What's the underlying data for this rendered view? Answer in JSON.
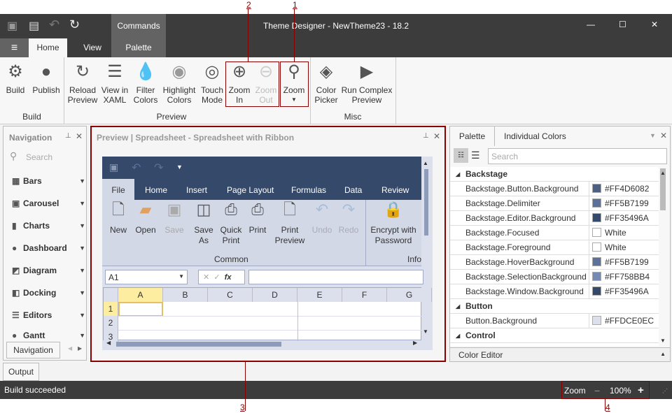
{
  "window": {
    "title": "Theme Designer  - NewTheme23 - 18.2",
    "context_tab": "Commands",
    "minimize": "—",
    "maximize": "☐",
    "close": "✕"
  },
  "qat": {
    "save": "save-icon",
    "save_all": "save-all-icon",
    "undo": "undo-icon",
    "redo": "redo-icon"
  },
  "tabs": {
    "menu": "≡",
    "home": "Home",
    "view": "View",
    "palette": "Palette"
  },
  "ribbon": {
    "groups": [
      {
        "label": "Build",
        "items": [
          {
            "label": "Build",
            "icon": "gear-icon"
          },
          {
            "label": "Publish",
            "icon": "globe-icon"
          }
        ]
      },
      {
        "label": "Preview",
        "items": [
          {
            "label": "Reload\nPreview"
          },
          {
            "label": "View in\nXAML"
          },
          {
            "label": "Filter\nColors"
          },
          {
            "label": "Highlight\nColors"
          },
          {
            "label": "Touch\nMode"
          },
          {
            "label": "Zoom\nIn"
          },
          {
            "label": "Zoom\nOut"
          },
          {
            "label": "Zoom"
          }
        ]
      },
      {
        "label": "Misc",
        "items": [
          {
            "label": "Color\nPicker"
          },
          {
            "label": "Run Complex\nPreview"
          }
        ]
      }
    ]
  },
  "callouts": [
    "1",
    "2",
    "3",
    "4"
  ],
  "navigation": {
    "title": "Navigation",
    "search_placeholder": "Search",
    "items": [
      "Bars",
      "Carousel",
      "Charts",
      "Dashboard",
      "Diagram",
      "Docking",
      "Editors",
      "Gantt"
    ],
    "bottom_tab": "Navigation"
  },
  "preview": {
    "title": "Preview | Spreadsheet - Spreadsheet with Ribbon",
    "tabs": [
      "File",
      "Home",
      "Insert",
      "Page Layout",
      "Formulas",
      "Data",
      "Review"
    ],
    "buttons": [
      "New",
      "Open",
      "Save",
      "Save\nAs",
      "Quick\nPrint",
      "Print",
      "Print\nPreview",
      "Undo",
      "Redo",
      "Encrypt with\nPassword"
    ],
    "group_common": "Common",
    "group_info": "Info",
    "name_box": "A1",
    "fx": "fx",
    "columns": [
      "A",
      "B",
      "C",
      "D",
      "E",
      "F",
      "G"
    ],
    "rows": [
      "1",
      "2",
      "3"
    ]
  },
  "palette": {
    "tabs": [
      "Palette",
      "Individual Colors"
    ],
    "search_placeholder": "Search",
    "categories": [
      {
        "name": "Backstage",
        "rows": [
          {
            "name": "Backstage.Button.Background",
            "value": "#FF4D6082",
            "color": "#4D6082"
          },
          {
            "name": "Backstage.Delimiter",
            "value": "#FF5B7199",
            "color": "#5B7199"
          },
          {
            "name": "Backstage.Editor.Background",
            "value": "#FF35496A",
            "color": "#35496A"
          },
          {
            "name": "Backstage.Focused",
            "value": "White",
            "color": "#FFFFFF"
          },
          {
            "name": "Backstage.Foreground",
            "value": "White",
            "color": "#FFFFFF"
          },
          {
            "name": "Backstage.HoverBackground",
            "value": "#FF5B7199",
            "color": "#5B7199"
          },
          {
            "name": "Backstage.SelectionBackground",
            "value": "#FF758BB4",
            "color": "#758BB4"
          },
          {
            "name": "Backstage.Window.Background",
            "value": "#FF35496A",
            "color": "#35496A"
          }
        ]
      },
      {
        "name": "Button",
        "rows": [
          {
            "name": "Button.Background",
            "value": "#FFDCE0EC",
            "color": "#DCE0EC"
          }
        ]
      },
      {
        "name": "Control",
        "rows": []
      }
    ],
    "color_editor": "Color Editor"
  },
  "output_tab": "Output",
  "status": {
    "text": "Build succeeded",
    "zoom_label": "Zoom",
    "zoom_minus": "−",
    "zoom_value": "100%",
    "zoom_plus": "+"
  }
}
